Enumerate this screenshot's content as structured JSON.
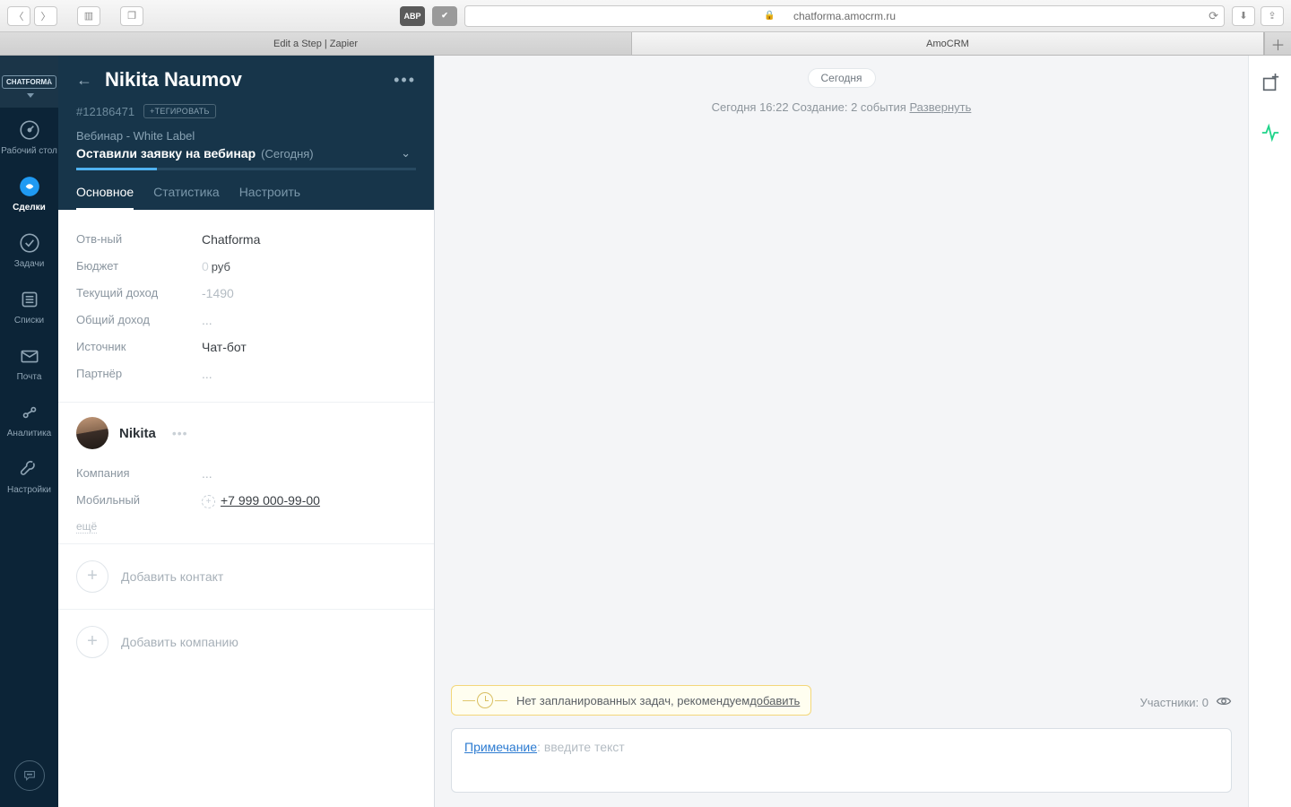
{
  "browser": {
    "url": "chatforma.amocrm.ru",
    "tabs": [
      {
        "title": "Edit a Step | Zapier",
        "active": false
      },
      {
        "title": "AmoCRM",
        "active": true
      }
    ],
    "abp": "ABP"
  },
  "logo": "CHATFORMA",
  "nav": {
    "desktop": "Рабочий стол",
    "deals": "Сделки",
    "tasks": "Задачи",
    "lists": "Списки",
    "mail": "Почта",
    "analytics": "Аналитика",
    "settings": "Настройки"
  },
  "lead": {
    "name": "Nikita Naumov",
    "id": "#12186471",
    "tag_button": "+ТЕГИРОВАТЬ",
    "pipeline": "Вебинар - White Label",
    "stage": "Оставили заявку на вебинар",
    "stage_date": "(Сегодня)"
  },
  "lead_tabs": {
    "main": "Основное",
    "stats": "Статистика",
    "setup": "Настроить"
  },
  "fields": {
    "responsible_label": "Отв-ный",
    "responsible_value": "Chatforma",
    "budget_label": "Бюджет",
    "budget_value": "0",
    "budget_currency": "руб",
    "current_income_label": "Текущий доход",
    "current_income_value": "-1490",
    "total_income_label": "Общий доход",
    "total_income_value": "...",
    "source_label": "Источник",
    "source_value": "Чат-бот",
    "partner_label": "Партнёр",
    "partner_value": "..."
  },
  "contact": {
    "name": "Nikita",
    "company_label": "Компания",
    "company_value": "...",
    "mobile_label": "Мобильный",
    "mobile_value": "+7 999 000-99-00",
    "more": "ещё"
  },
  "add": {
    "contact": "Добавить контакт",
    "company": "Добавить компанию"
  },
  "timeline": {
    "today": "Сегодня",
    "event_prefix": "Сегодня 16:22 Создание: 2 события ",
    "expand": "Развернуть",
    "task_banner_text": "Нет запланированных задач, рекомендуем ",
    "task_banner_link": "добавить",
    "participants": "Участники: 0",
    "note_label": "Примечание",
    "note_placeholder": ": введите текст"
  }
}
